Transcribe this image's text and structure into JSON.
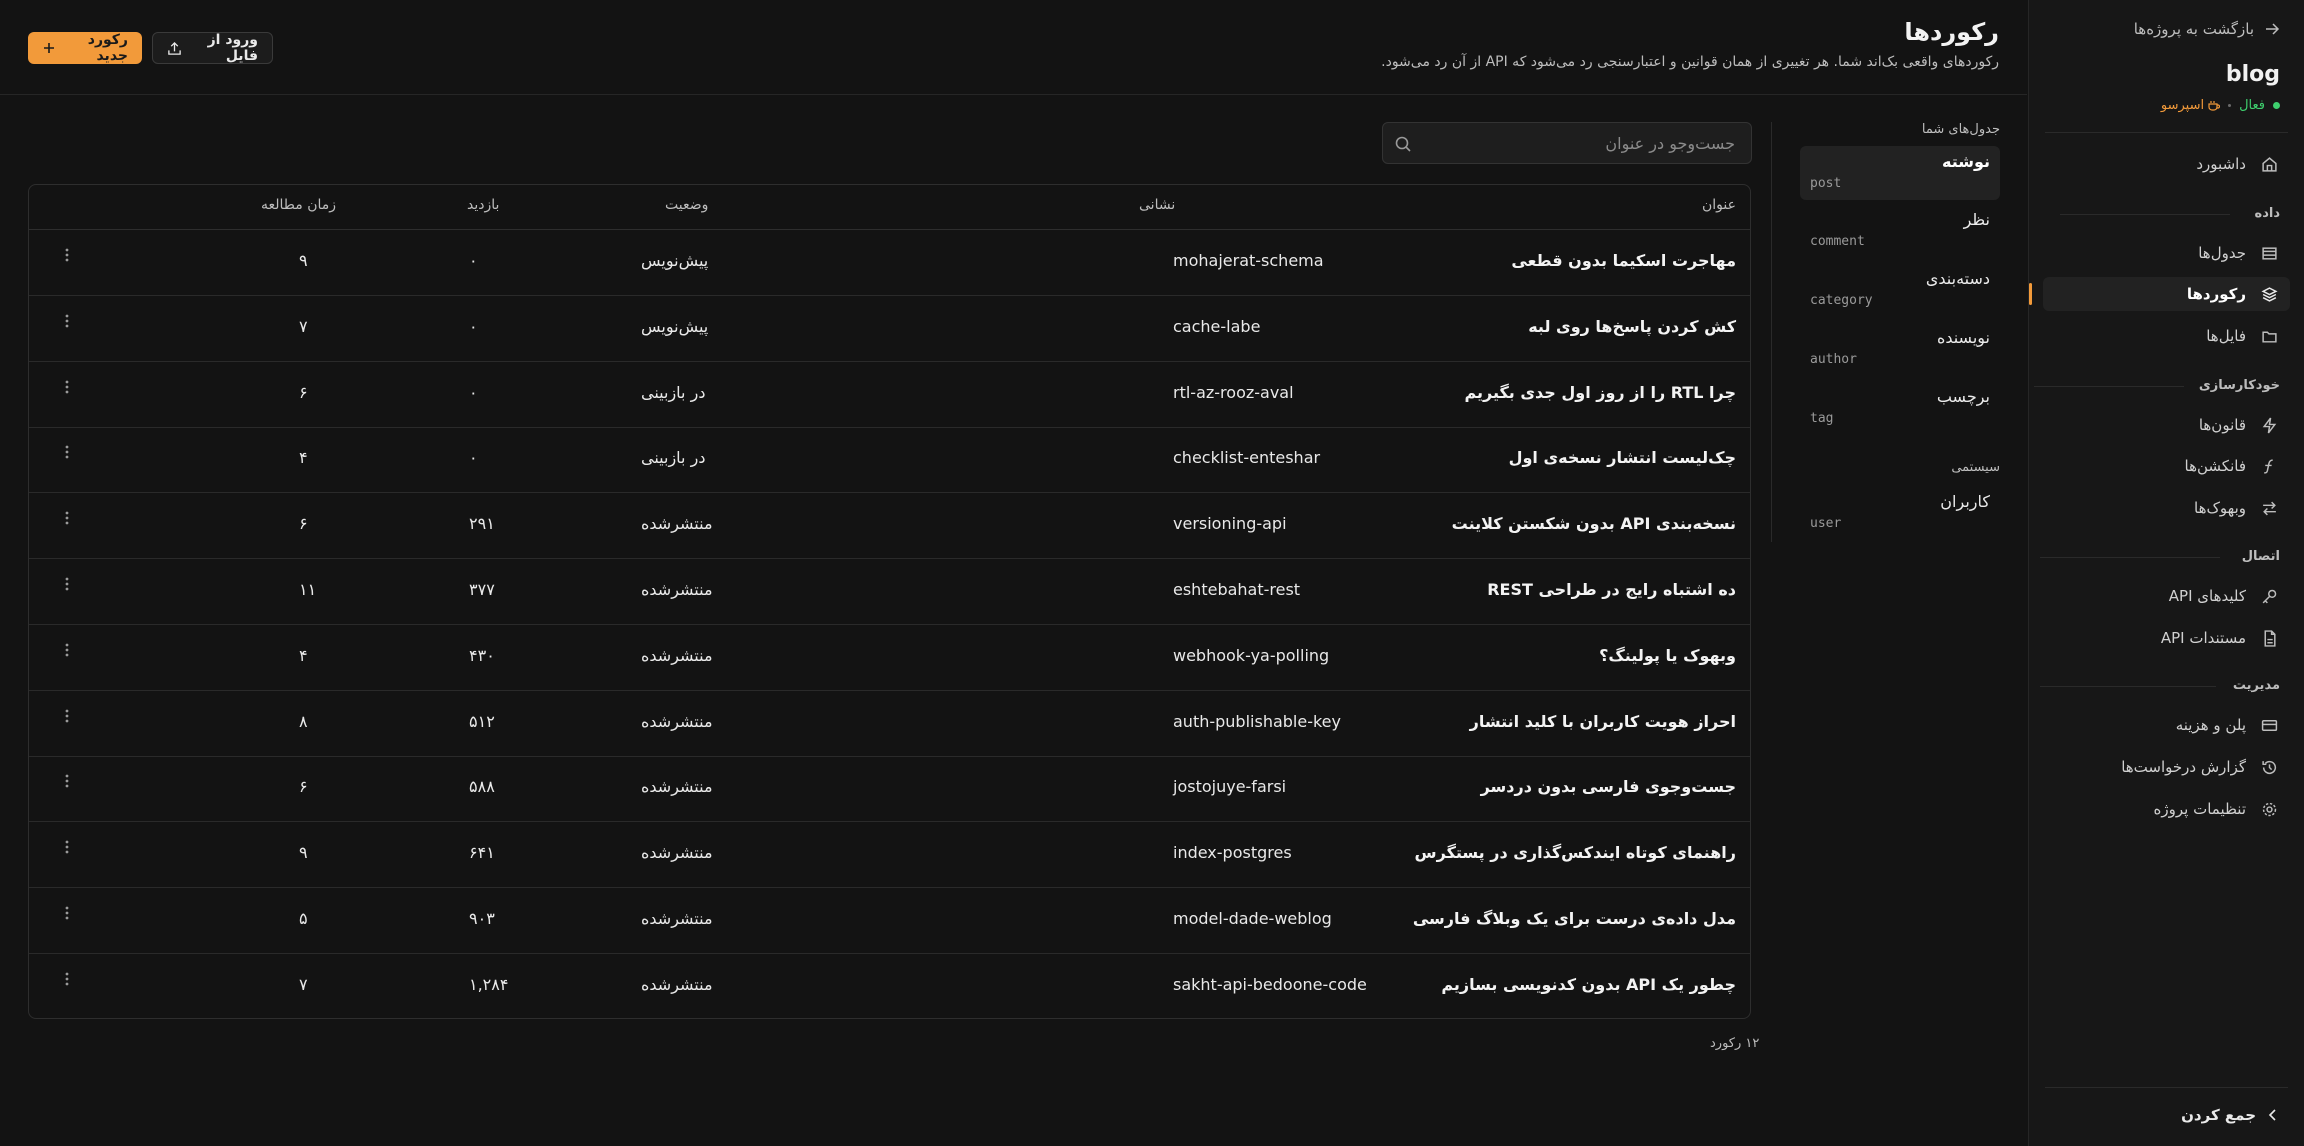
{
  "sidebar": {
    "back_label": "بازگشت به پروژه‌ها",
    "project_name": "blog",
    "status_active": "فعال",
    "status_plan": "اسپرسو",
    "sections": [
      {
        "label": "داده"
      },
      {
        "label": "خودکارسازی"
      },
      {
        "label": "اتصال"
      },
      {
        "label": "مدیریت"
      }
    ],
    "items": [
      {
        "label": "داشبورد",
        "icon": "home-icon"
      },
      {
        "label": "جدول‌ها",
        "icon": "table-icon"
      },
      {
        "label": "رکوردها",
        "icon": "layers-icon"
      },
      {
        "label": "فایل‌ها",
        "icon": "folder-icon"
      },
      {
        "label": "قانون‌ها",
        "icon": "bolt-icon"
      },
      {
        "label": "فانکشن‌ها",
        "icon": "function-icon"
      },
      {
        "label": "وبهوک‌ها",
        "icon": "webhook-icon"
      },
      {
        "label": "کلیدهای API",
        "icon": "key-icon"
      },
      {
        "label": "مستندات API",
        "icon": "doc-icon"
      },
      {
        "label": "پلن و هزینه",
        "icon": "card-icon"
      },
      {
        "label": "گزارش درخواست‌ها",
        "icon": "history-icon"
      },
      {
        "label": "تنظیمات پروژه",
        "icon": "gear-icon"
      }
    ],
    "collapse_label": "جمع کردن"
  },
  "header": {
    "title": "رکوردها",
    "subtitle": "رکوردهای واقعی بک‌اند شما. هر تغییری از همان قوانین و اعتبارسنجی رد می‌شود که API از آن رد می‌شود.",
    "new_record_label": "رکورد جدید",
    "import_label": "ورود از فایل"
  },
  "tables_panel": {
    "heading": "جدول‌های شما",
    "tables": [
      {
        "name": "نوشته",
        "slug": "post"
      },
      {
        "name": "نظر",
        "slug": "comment"
      },
      {
        "name": "دسته‌بندی",
        "slug": "category"
      },
      {
        "name": "نویسنده",
        "slug": "author"
      },
      {
        "name": "برچسب",
        "slug": "tag"
      }
    ],
    "system_heading": "سیستمی",
    "system_tables": [
      {
        "name": "کاربران",
        "slug": "user"
      }
    ]
  },
  "search": {
    "placeholder": "جست‌وجو در عنوان"
  },
  "records": {
    "columns": [
      "عنوان",
      "نشانی",
      "وضعیت",
      "بازدید",
      "زمان مطالعه"
    ],
    "rows": [
      {
        "title": "مهاجرت اسکیما بدون قطعی",
        "slug": "mohajerat-schema",
        "status": "پیش‌نویس",
        "views": "۰",
        "read": "۹"
      },
      {
        "title": "کش کردن پاسخ‌ها روی لبه",
        "slug": "cache-labe",
        "status": "پیش‌نویس",
        "views": "۰",
        "read": "۷"
      },
      {
        "title": "چرا RTL را از روز اول جدی بگیریم",
        "slug": "rtl-az-rooz-aval",
        "status": "در بازبینی",
        "views": "۰",
        "read": "۶"
      },
      {
        "title": "چک‌لیست انتشار نسخه‌ی اول",
        "slug": "checklist-enteshar",
        "status": "در بازبینی",
        "views": "۰",
        "read": "۴"
      },
      {
        "title": "نسخه‌بندی API بدون شکستن کلاینت",
        "slug": "versioning-api",
        "status": "منتشرشده",
        "views": "۲۹۱",
        "read": "۶"
      },
      {
        "title": "ده اشتباه رایج در طراحی REST",
        "slug": "eshtebahat-rest",
        "status": "منتشرشده",
        "views": "۳۷۷",
        "read": "۱۱"
      },
      {
        "title": "وبهوک یا پولینگ؟",
        "slug": "webhook-ya-polling",
        "status": "منتشرشده",
        "views": "۴۳۰",
        "read": "۴"
      },
      {
        "title": "احراز هویت کاربران با کلید انتشار",
        "slug": "auth-publishable-key",
        "status": "منتشرشده",
        "views": "۵۱۲",
        "read": "۸"
      },
      {
        "title": "جست‌وجوی فارسی بدون دردسر",
        "slug": "jostojuye-farsi",
        "status": "منتشرشده",
        "views": "۵۸۸",
        "read": "۶"
      },
      {
        "title": "راهنمای کوتاه ایندکس‌گذاری در پستگرس",
        "slug": "index-postgres",
        "status": "منتشرشده",
        "views": "۶۴۱",
        "read": "۹"
      },
      {
        "title": "مدل داده‌ی درست برای یک وبلاگ فارسی",
        "slug": "model-dade-weblog",
        "status": "منتشرشده",
        "views": "۹۰۳",
        "read": "۵"
      },
      {
        "title": "چطور یک API بدون کدنویسی بسازیم",
        "slug": "sakht-api-bedoone-code",
        "status": "منتشرشده",
        "views": "۱,۲۸۴",
        "read": "۷"
      }
    ],
    "count_label": "۱۲ رکورد"
  },
  "colors": {
    "accent": "#f29a3a",
    "active_green": "#3ecf6e",
    "background": "#131313"
  }
}
